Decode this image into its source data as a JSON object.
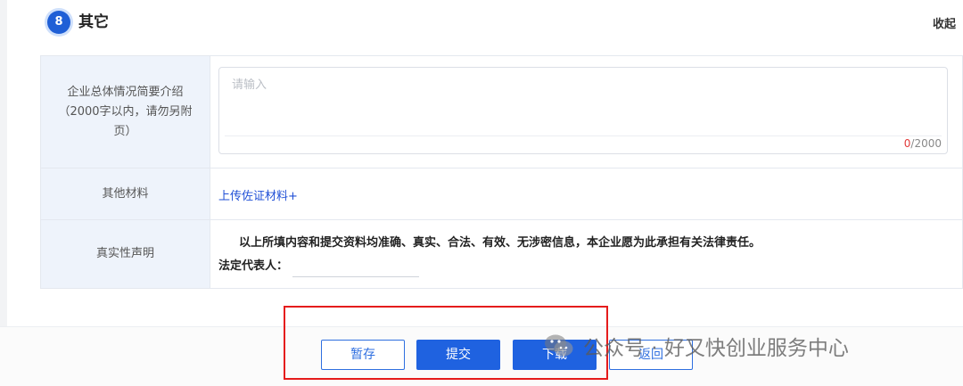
{
  "section": {
    "step_number": "8",
    "title": "其它",
    "collapse_label": "收起"
  },
  "form": {
    "intro": {
      "label": "企业总体情况简要介绍（2000字以内，请勿另附页）",
      "placeholder": "请输入",
      "value": "",
      "char_count_current": "0",
      "char_count_max": "/2000"
    },
    "materials": {
      "label": "其他材料",
      "upload_link": "上传佐证材料+"
    },
    "declaration": {
      "label": "真实性声明",
      "statement": "以上所填内容和提交资料均准确、真实、合法、有效、无涉密信息，本企业愿为此承担有关法律责任。",
      "legal_rep_label": "法定代表人："
    }
  },
  "actions": {
    "save_label": "暂存",
    "submit_label": "提交",
    "download_label": "下载",
    "back_label": "返回"
  },
  "colors": {
    "primary": "#1f62e0",
    "highlight": "#e51c1c",
    "label_bg": "#eef3fb"
  },
  "watermark": {
    "icon": "wechat-icon",
    "text": "公众号 · 好又快创业服务中心"
  }
}
